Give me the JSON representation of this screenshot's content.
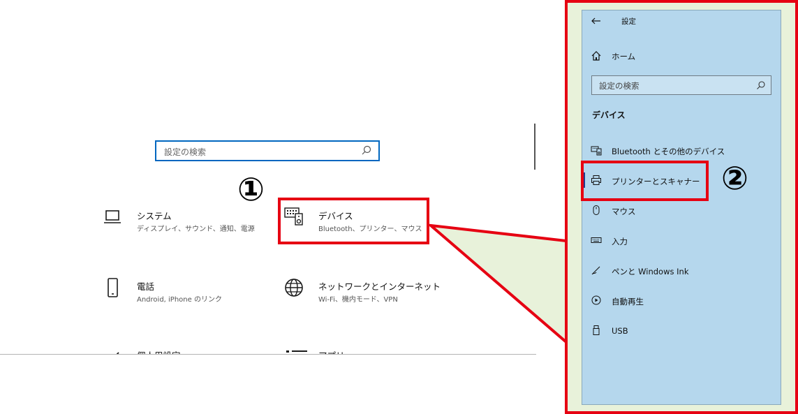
{
  "main": {
    "search_placeholder": "設定の検索",
    "categories": [
      {
        "title": "システム",
        "subtitle": "ディスプレイ、サウンド、通知、電源",
        "icon": "laptop-icon"
      },
      {
        "title": "デバイス",
        "subtitle": "Bluetooth、プリンター、マウス",
        "icon": "device-icon"
      },
      {
        "title": "電話",
        "subtitle": "Android, iPhone のリンク",
        "icon": "phone-icon"
      },
      {
        "title": "ネットワークとインターネット",
        "subtitle": "Wi-Fi、機内モード、VPN",
        "icon": "globe-icon"
      },
      {
        "title": "個人用設定",
        "icon": "pen-icon"
      },
      {
        "title": "アプリ",
        "icon": "apps-icon"
      }
    ]
  },
  "annotations": {
    "step1": "①",
    "step2": "②",
    "highlight_color": "#e60012"
  },
  "panel": {
    "back_label": "設定",
    "home_label": "ホーム",
    "search_placeholder": "設定の検索",
    "section_title": "デバイス",
    "items": [
      {
        "label": "Bluetooth とその他のデバイス",
        "icon": "bluetooth-device-icon"
      },
      {
        "label": "プリンターとスキャナー",
        "icon": "printer-icon",
        "selected": true
      },
      {
        "label": "マウス",
        "icon": "mouse-icon"
      },
      {
        "label": "入力",
        "icon": "keyboard-icon"
      },
      {
        "label": "ペンと Windows Ink",
        "icon": "pen-ink-icon"
      },
      {
        "label": "自動再生",
        "icon": "autoplay-icon"
      },
      {
        "label": "USB",
        "icon": "usb-icon"
      }
    ]
  }
}
